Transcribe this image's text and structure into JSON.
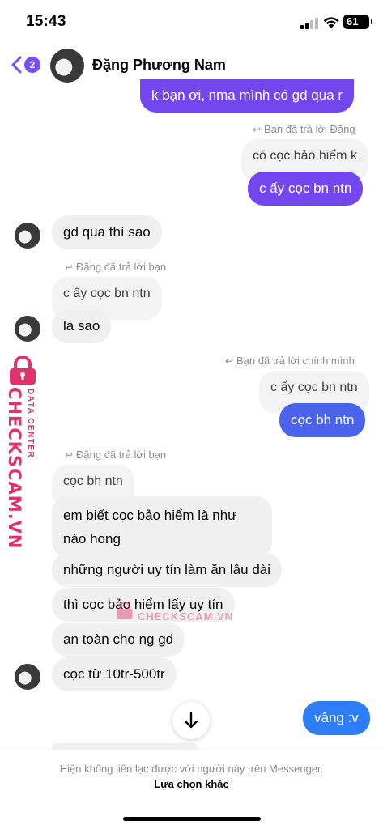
{
  "status_bar": {
    "time": "15:43",
    "battery": "61"
  },
  "header": {
    "back_count": "2",
    "name": "Đặng Phương Nam"
  },
  "messages": {
    "m1": "k bạn ơi, nma mình có gd qua r",
    "reply1": "Bạn đã trả lời Đặng",
    "q1": "có cọc bảo hiểm k",
    "m2": "c ấy cọc bn ntn",
    "m3": "gd qua thì sao",
    "reply2": "Đặng đã trả lời bạn",
    "q2": "c ấy cọc bn ntn",
    "m4": "là sao",
    "reply3": "Bạn đã trả lời chính mình",
    "q3": "c ấy cọc bn ntn",
    "m5": "cọc bh ntn",
    "reply4": "Đặng đã trả lời bạn",
    "q4": "cọc bh ntn",
    "m6a": "em biết cọc bảo hiểm là như",
    "m6b": "nào hong",
    "m7": "những người uy tín làm ăn lâu dài",
    "m8": "thì cọc bảo hiểm lấy uy tín",
    "m9": "an toàn cho ng gd",
    "m10": "cọc từ 10tr-500tr",
    "m11": "vâng :v"
  },
  "watermark": {
    "side": "CHECKSCAM.VN",
    "side_sub": "DATA CENTER",
    "center": "CHECKSCAM.VN"
  },
  "footer": {
    "note": "Hiện không liên lạc được với người này trên Messenger.",
    "other": "Lựa chọn khác"
  },
  "colors": {
    "outgoing": "#7346f0",
    "incoming": "#f0f0f0",
    "watermark": "#e0336d"
  },
  "icons": [
    "signal-icon",
    "wifi-icon",
    "battery-icon",
    "back-icon",
    "reply-arrow-icon",
    "lock-icon",
    "arrow-down-icon"
  ]
}
